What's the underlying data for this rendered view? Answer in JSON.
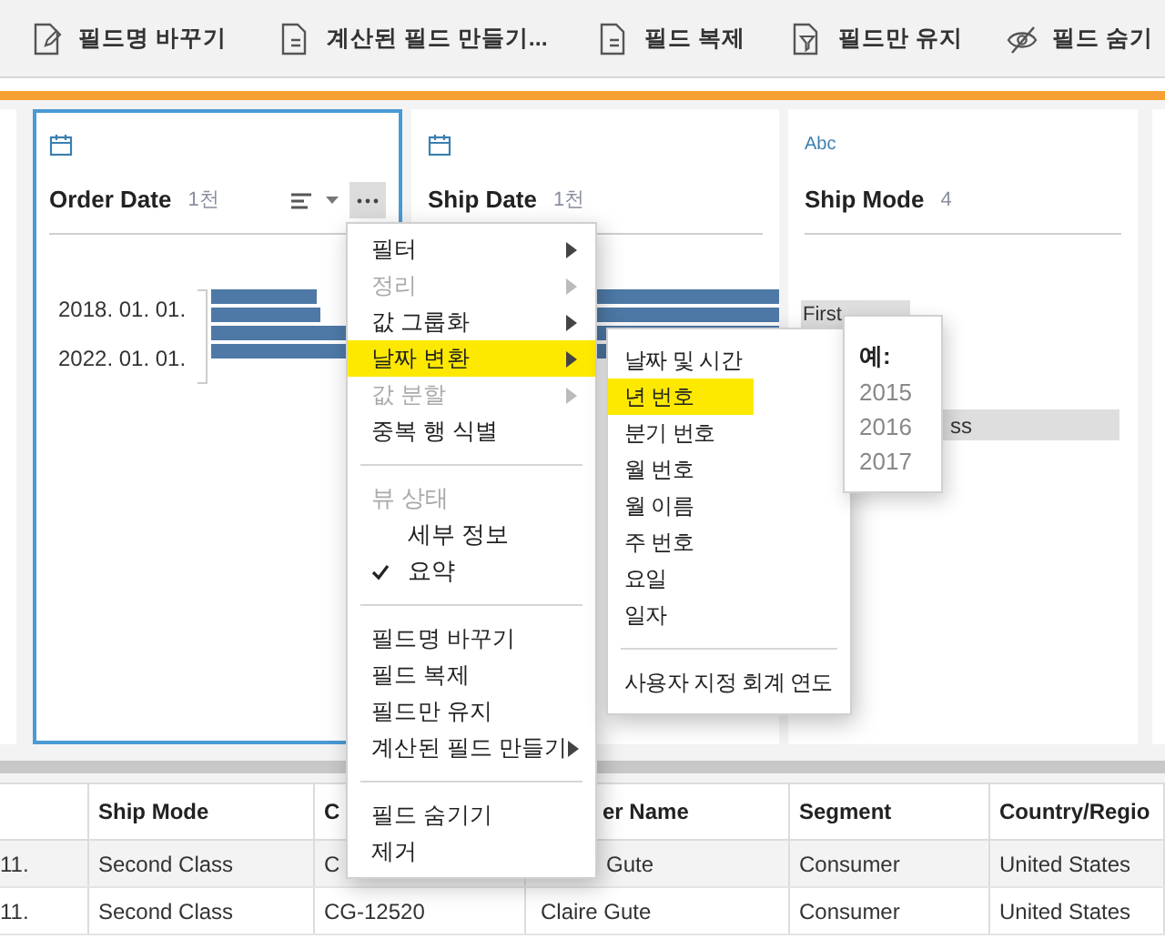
{
  "toolbar": [
    {
      "label": "필드명 바꾸기"
    },
    {
      "label": "계산된 필드 만들기..."
    },
    {
      "label": "필드 복제"
    },
    {
      "label": "필드만 유지"
    },
    {
      "label": "필드 숨기"
    }
  ],
  "cards": [
    {
      "kind": "date",
      "name": "Order Date",
      "count": "1천",
      "selected": true,
      "labels": [
        "2018. 01. 01.",
        "2022. 01. 01."
      ]
    },
    {
      "kind": "date",
      "name": "Ship Date",
      "count": "1천",
      "selected": false
    },
    {
      "kind": "text",
      "type_label": "Abc",
      "name": "Ship Mode",
      "count": "4",
      "selected": false,
      "values": [
        "First",
        "ss"
      ]
    }
  ],
  "menu": [
    {
      "kind": "item",
      "label": "필터",
      "submenu": true,
      "disabled": false,
      "selected": false
    },
    {
      "kind": "item",
      "label": "정리",
      "submenu": true,
      "disabled": true,
      "selected": false
    },
    {
      "kind": "item",
      "label": "값 그룹화",
      "submenu": true,
      "disabled": false,
      "selected": false
    },
    {
      "kind": "item",
      "label": "날짜 변환",
      "submenu": true,
      "disabled": false,
      "selected": true
    },
    {
      "kind": "item",
      "label": "값 분할",
      "submenu": true,
      "disabled": true,
      "selected": false
    },
    {
      "kind": "item",
      "label": "중복 행 식별",
      "submenu": false,
      "disabled": false,
      "selected": false
    },
    {
      "kind": "separator"
    },
    {
      "kind": "header",
      "label": "뷰 상태"
    },
    {
      "kind": "check",
      "label": "세부 정보",
      "checked": false
    },
    {
      "kind": "check",
      "label": "요약",
      "checked": true
    },
    {
      "kind": "separator"
    },
    {
      "kind": "item",
      "label": "필드명 바꾸기",
      "submenu": false,
      "disabled": false,
      "selected": false
    },
    {
      "kind": "item",
      "label": "필드 복제",
      "submenu": false,
      "disabled": false,
      "selected": false
    },
    {
      "kind": "item",
      "label": "필드만 유지",
      "submenu": false,
      "disabled": false,
      "selected": false
    },
    {
      "kind": "item",
      "label": "계산된 필드 만들기",
      "submenu": true,
      "disabled": false,
      "selected": false
    },
    {
      "kind": "separator"
    },
    {
      "kind": "item",
      "label": "필드 숨기기",
      "submenu": false,
      "disabled": false,
      "selected": false
    },
    {
      "kind": "item",
      "label": "제거",
      "submenu": false,
      "disabled": false,
      "selected": false
    }
  ],
  "submenu": [
    {
      "kind": "item",
      "label": "날짜 및 시간",
      "selected": false
    },
    {
      "kind": "item",
      "label": "년 번호",
      "selected": true
    },
    {
      "kind": "item",
      "label": "분기 번호",
      "selected": false
    },
    {
      "kind": "item",
      "label": "월 번호",
      "selected": false
    },
    {
      "kind": "item",
      "label": "월 이름",
      "selected": false
    },
    {
      "kind": "item",
      "label": "주 번호",
      "selected": false
    },
    {
      "kind": "item",
      "label": "요일",
      "selected": false
    },
    {
      "kind": "item",
      "label": "일자",
      "selected": false
    },
    {
      "kind": "separator"
    },
    {
      "kind": "item",
      "label": "사용자 지정 회계 연도",
      "selected": false
    }
  ],
  "example": {
    "title": "예:",
    "values": [
      "2015",
      "2016",
      "2017"
    ]
  },
  "table": {
    "columns": [
      "",
      "Ship Mode",
      "C",
      "er Name",
      "Segment",
      "Country/Regio"
    ],
    "rows": [
      [
        "11.",
        "Second Class",
        "C",
        "Gute",
        "Consumer",
        "United States"
      ],
      [
        "11.",
        "Second Class",
        "CG-12520",
        "Claire Gute",
        "Consumer",
        "United States"
      ]
    ]
  }
}
